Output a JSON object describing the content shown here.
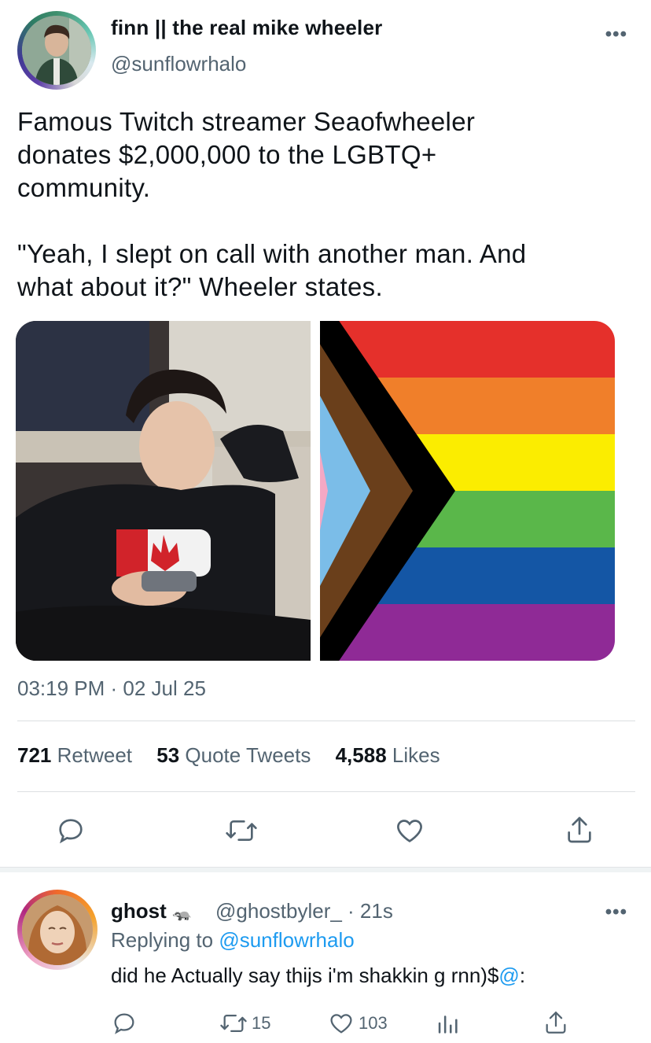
{
  "tweet": {
    "display_name": "finn || the real mike wheeler",
    "handle": "@sunflowrhalo",
    "more_icon": "more-horizontal-icon",
    "text": "Famous Twitch streamer Seaofwheeler\ndonates $2,000,000 to the LGBTQ+\ncommunity.\n\n\"Yeah, I slept on call with another man. And\nwhat about it?\" Wheeler states.",
    "timestamp": "03:19 PM · 02 Jul 25",
    "flag_colors": [
      "#e5302b",
      "#f07f2a",
      "#fbed00",
      "#5ab74a",
      "#1456a5",
      "#8f2a96"
    ],
    "flag_chevrons": [
      "#000000",
      "#6a3f1b",
      "#7bbde8",
      "#f4a8c4",
      "#ffffff"
    ]
  },
  "stats": {
    "retweets_count": "721",
    "retweets_label": "Retweet",
    "quotes_count": "53",
    "quotes_label": "Quote Tweets",
    "likes_count": "4,588",
    "likes_label": "Likes"
  },
  "actions": {
    "reply_icon": "reply-icon",
    "retweet_icon": "retweet-icon",
    "like_icon": "heart-icon",
    "share_icon": "share-icon"
  },
  "reply": {
    "display_name": "ghost",
    "name_emoji": "🦡",
    "handle_time": "@ghostbyler_ · 21s",
    "replying_prefix": "Replying to",
    "replying_handle": "@sunflowrhalo",
    "text_plain": "did he Actually say thijs i'm shakkin g rnn)$",
    "text_mention": "@",
    "text_suffix": ":",
    "retweet_count": "15",
    "like_count": "103"
  },
  "colors": {
    "link": "#1d9bf0",
    "secondary_text": "#536471",
    "primary_text": "#0f1419"
  }
}
